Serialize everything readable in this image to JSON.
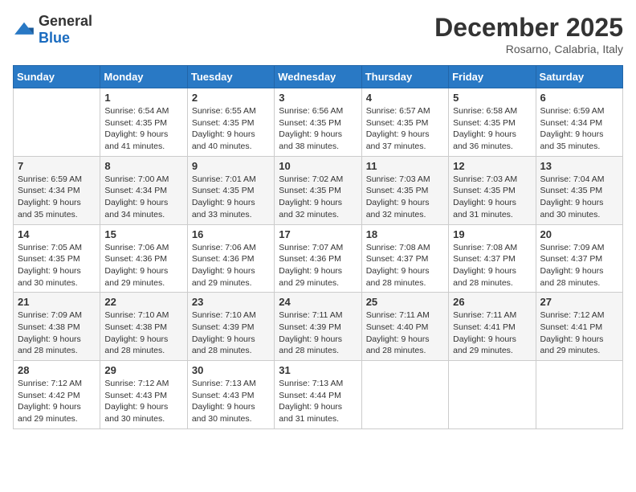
{
  "logo": {
    "text_general": "General",
    "text_blue": "Blue"
  },
  "header": {
    "month": "December 2025",
    "location": "Rosarno, Calabria, Italy"
  },
  "weekdays": [
    "Sunday",
    "Monday",
    "Tuesday",
    "Wednesday",
    "Thursday",
    "Friday",
    "Saturday"
  ],
  "weeks": [
    [
      {
        "day": "",
        "sunrise": "",
        "sunset": "",
        "daylight": ""
      },
      {
        "day": "1",
        "sunrise": "Sunrise: 6:54 AM",
        "sunset": "Sunset: 4:35 PM",
        "daylight": "Daylight: 9 hours and 41 minutes."
      },
      {
        "day": "2",
        "sunrise": "Sunrise: 6:55 AM",
        "sunset": "Sunset: 4:35 PM",
        "daylight": "Daylight: 9 hours and 40 minutes."
      },
      {
        "day": "3",
        "sunrise": "Sunrise: 6:56 AM",
        "sunset": "Sunset: 4:35 PM",
        "daylight": "Daylight: 9 hours and 38 minutes."
      },
      {
        "day": "4",
        "sunrise": "Sunrise: 6:57 AM",
        "sunset": "Sunset: 4:35 PM",
        "daylight": "Daylight: 9 hours and 37 minutes."
      },
      {
        "day": "5",
        "sunrise": "Sunrise: 6:58 AM",
        "sunset": "Sunset: 4:35 PM",
        "daylight": "Daylight: 9 hours and 36 minutes."
      },
      {
        "day": "6",
        "sunrise": "Sunrise: 6:59 AM",
        "sunset": "Sunset: 4:34 PM",
        "daylight": "Daylight: 9 hours and 35 minutes."
      }
    ],
    [
      {
        "day": "7",
        "sunrise": "Sunrise: 6:59 AM",
        "sunset": "Sunset: 4:34 PM",
        "daylight": "Daylight: 9 hours and 35 minutes."
      },
      {
        "day": "8",
        "sunrise": "Sunrise: 7:00 AM",
        "sunset": "Sunset: 4:34 PM",
        "daylight": "Daylight: 9 hours and 34 minutes."
      },
      {
        "day": "9",
        "sunrise": "Sunrise: 7:01 AM",
        "sunset": "Sunset: 4:35 PM",
        "daylight": "Daylight: 9 hours and 33 minutes."
      },
      {
        "day": "10",
        "sunrise": "Sunrise: 7:02 AM",
        "sunset": "Sunset: 4:35 PM",
        "daylight": "Daylight: 9 hours and 32 minutes."
      },
      {
        "day": "11",
        "sunrise": "Sunrise: 7:03 AM",
        "sunset": "Sunset: 4:35 PM",
        "daylight": "Daylight: 9 hours and 32 minutes."
      },
      {
        "day": "12",
        "sunrise": "Sunrise: 7:03 AM",
        "sunset": "Sunset: 4:35 PM",
        "daylight": "Daylight: 9 hours and 31 minutes."
      },
      {
        "day": "13",
        "sunrise": "Sunrise: 7:04 AM",
        "sunset": "Sunset: 4:35 PM",
        "daylight": "Daylight: 9 hours and 30 minutes."
      }
    ],
    [
      {
        "day": "14",
        "sunrise": "Sunrise: 7:05 AM",
        "sunset": "Sunset: 4:35 PM",
        "daylight": "Daylight: 9 hours and 30 minutes."
      },
      {
        "day": "15",
        "sunrise": "Sunrise: 7:06 AM",
        "sunset": "Sunset: 4:36 PM",
        "daylight": "Daylight: 9 hours and 29 minutes."
      },
      {
        "day": "16",
        "sunrise": "Sunrise: 7:06 AM",
        "sunset": "Sunset: 4:36 PM",
        "daylight": "Daylight: 9 hours and 29 minutes."
      },
      {
        "day": "17",
        "sunrise": "Sunrise: 7:07 AM",
        "sunset": "Sunset: 4:36 PM",
        "daylight": "Daylight: 9 hours and 29 minutes."
      },
      {
        "day": "18",
        "sunrise": "Sunrise: 7:08 AM",
        "sunset": "Sunset: 4:37 PM",
        "daylight": "Daylight: 9 hours and 28 minutes."
      },
      {
        "day": "19",
        "sunrise": "Sunrise: 7:08 AM",
        "sunset": "Sunset: 4:37 PM",
        "daylight": "Daylight: 9 hours and 28 minutes."
      },
      {
        "day": "20",
        "sunrise": "Sunrise: 7:09 AM",
        "sunset": "Sunset: 4:37 PM",
        "daylight": "Daylight: 9 hours and 28 minutes."
      }
    ],
    [
      {
        "day": "21",
        "sunrise": "Sunrise: 7:09 AM",
        "sunset": "Sunset: 4:38 PM",
        "daylight": "Daylight: 9 hours and 28 minutes."
      },
      {
        "day": "22",
        "sunrise": "Sunrise: 7:10 AM",
        "sunset": "Sunset: 4:38 PM",
        "daylight": "Daylight: 9 hours and 28 minutes."
      },
      {
        "day": "23",
        "sunrise": "Sunrise: 7:10 AM",
        "sunset": "Sunset: 4:39 PM",
        "daylight": "Daylight: 9 hours and 28 minutes."
      },
      {
        "day": "24",
        "sunrise": "Sunrise: 7:11 AM",
        "sunset": "Sunset: 4:39 PM",
        "daylight": "Daylight: 9 hours and 28 minutes."
      },
      {
        "day": "25",
        "sunrise": "Sunrise: 7:11 AM",
        "sunset": "Sunset: 4:40 PM",
        "daylight": "Daylight: 9 hours and 28 minutes."
      },
      {
        "day": "26",
        "sunrise": "Sunrise: 7:11 AM",
        "sunset": "Sunset: 4:41 PM",
        "daylight": "Daylight: 9 hours and 29 minutes."
      },
      {
        "day": "27",
        "sunrise": "Sunrise: 7:12 AM",
        "sunset": "Sunset: 4:41 PM",
        "daylight": "Daylight: 9 hours and 29 minutes."
      }
    ],
    [
      {
        "day": "28",
        "sunrise": "Sunrise: 7:12 AM",
        "sunset": "Sunset: 4:42 PM",
        "daylight": "Daylight: 9 hours and 29 minutes."
      },
      {
        "day": "29",
        "sunrise": "Sunrise: 7:12 AM",
        "sunset": "Sunset: 4:43 PM",
        "daylight": "Daylight: 9 hours and 30 minutes."
      },
      {
        "day": "30",
        "sunrise": "Sunrise: 7:13 AM",
        "sunset": "Sunset: 4:43 PM",
        "daylight": "Daylight: 9 hours and 30 minutes."
      },
      {
        "day": "31",
        "sunrise": "Sunrise: 7:13 AM",
        "sunset": "Sunset: 4:44 PM",
        "daylight": "Daylight: 9 hours and 31 minutes."
      },
      {
        "day": "",
        "sunrise": "",
        "sunset": "",
        "daylight": ""
      },
      {
        "day": "",
        "sunrise": "",
        "sunset": "",
        "daylight": ""
      },
      {
        "day": "",
        "sunrise": "",
        "sunset": "",
        "daylight": ""
      }
    ]
  ]
}
